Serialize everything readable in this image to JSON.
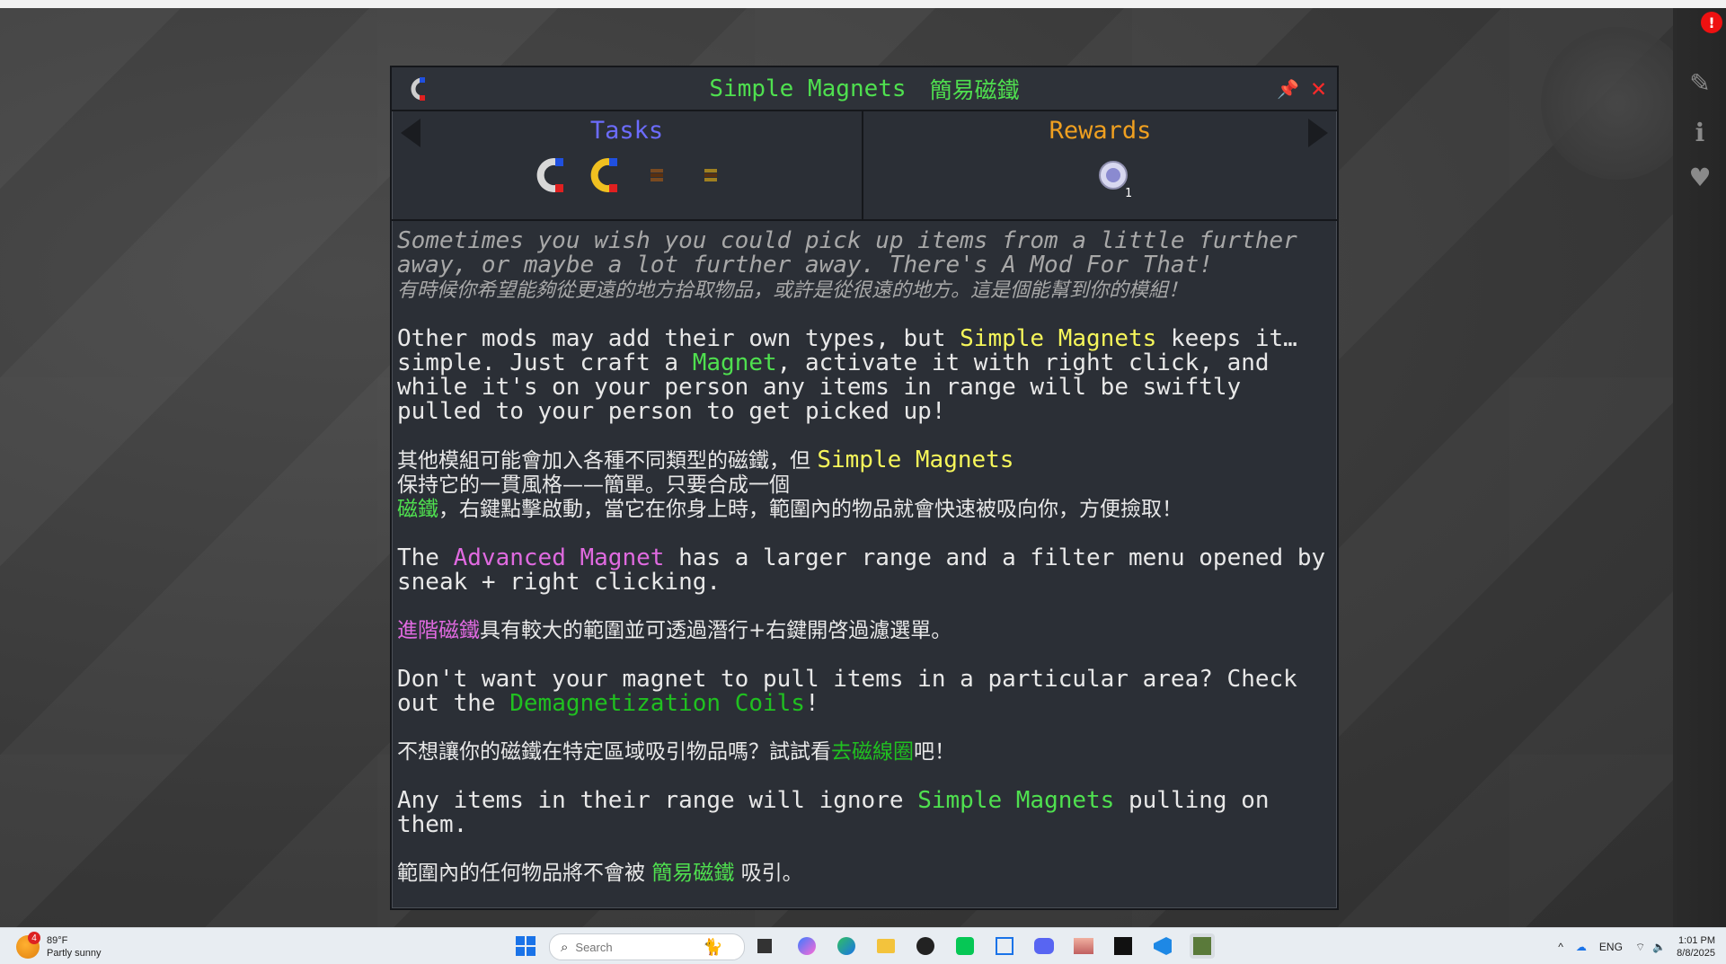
{
  "quest": {
    "title_en": "Simple Magnets",
    "title_zh": "簡易磁鐵",
    "tasks_label": "Tasks",
    "rewards_label": "Rewards",
    "reward_count": "1"
  },
  "description": {
    "intro_en": "Sometimes you wish you could pick up items from a little further away, or maybe a lot further away. There's A Mod For That!",
    "intro_zh": "有時候你希望能夠從更遠的地方拾取物品，或許是從很遠的地方。這是個能幫到你的模組！",
    "p1_a": "Other mods may add their own types, but ",
    "p1_hl1": "Simple Magnets",
    "p1_b": " keeps it…simple. Just craft a ",
    "p1_hl2": "Magnet",
    "p1_c": ", activate it with right click, and while it's on your person any items in range will be swiftly pulled to your person to get picked up!",
    "p2_a": "其他模組可能會加入各種不同類型的磁鐵，但 ",
    "p2_hl1": "Simple Magnets",
    "p2_b": "\n保持它的一貫風格——簡單。只要合成一個\n",
    "p2_hl2": "磁鐵",
    "p2_c": "，右鍵點擊啟動，當它在你身上時，範圍內的物品就會快速被吸向你，方便撿取！",
    "p3_a": "The ",
    "p3_hl": "Advanced Magnet",
    "p3_b": " has a larger range and a filter menu opened by sneak + right clicking.",
    "p4_hl": "進階磁鐵",
    "p4_b": "具有較大的範圍並可透過潛行+右鍵開啓過濾選單。",
    "p5_a": "Don't want your magnet to pull items in a particular area? Check out the ",
    "p5_hl": "Demagnetization Coils",
    "p5_b": "!",
    "p6_a": "不想讓你的磁鐵在特定區域吸引物品嗎？試試看",
    "p6_hl": "去磁線圈",
    "p6_b": "吧！",
    "p7_a": "Any items in their range will ignore ",
    "p7_hl": "Simple Magnets",
    "p7_b": " pulling on them.",
    "p8_a": "範圍內的任何物品將不會被 ",
    "p8_hl": "簡易磁鐵",
    "p8_b": " 吸引。"
  },
  "taskbar": {
    "weather_temp": "89°F",
    "weather_desc": "Partly sunny",
    "weather_badge": "4",
    "search_placeholder": "Search",
    "lang": "ENG",
    "time": "1:01 PM",
    "date": "8/8/2025"
  },
  "colors": {
    "title_green": "#4fe04f",
    "tasks_blue": "#6c6cff",
    "rewards_orange": "#f0a020",
    "highlight_yellow": "#f6f65a",
    "highlight_pink": "#e06ae0",
    "close_red": "#ff2a2a"
  }
}
